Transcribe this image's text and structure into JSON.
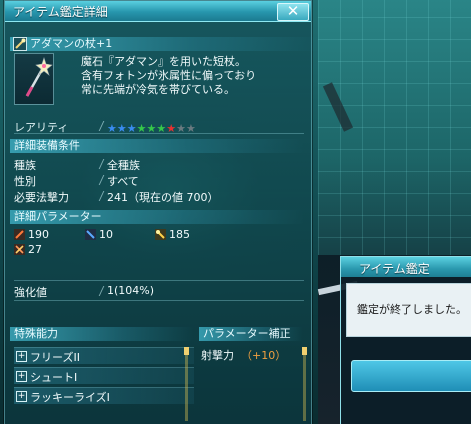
{
  "window": {
    "title": "アイテム鑑定詳細",
    "close_label": "✕"
  },
  "item": {
    "name": "アダマンの杖+1",
    "description_lines": [
      "魔石『アダマン』を用いた短杖。",
      "含有フォトンが氷属性に偏っており",
      "常に先端が冷気を帯びている。"
    ],
    "rarity_label": "レアリティ",
    "rarity_stars": [
      {
        "glyph": "★",
        "color": "#3a8cf0"
      },
      {
        "glyph": "★",
        "color": "#3a8cf0"
      },
      {
        "glyph": "★",
        "color": "#3a8cf0"
      },
      {
        "glyph": "★",
        "color": "#35c84a"
      },
      {
        "glyph": "★",
        "color": "#35c84a"
      },
      {
        "glyph": "★",
        "color": "#35c84a"
      },
      {
        "glyph": "★",
        "color": "#e83030"
      },
      {
        "glyph": "★",
        "color": "#6a7a80"
      },
      {
        "glyph": "★",
        "color": "#6a7a80"
      }
    ]
  },
  "equip_conditions": {
    "header": "詳細装備条件",
    "rows": [
      {
        "label": "種族",
        "value": "全種族"
      },
      {
        "label": "性別",
        "value": "すべて"
      },
      {
        "label": "必要法撃力",
        "value": "241（現在の値 700）"
      }
    ]
  },
  "parameters": {
    "header": "詳細パラメーター",
    "stats": [
      {
        "icon": "sword-icon",
        "value": "190"
      },
      {
        "icon": "gun-icon",
        "value": "10"
      },
      {
        "icon": "wand-icon",
        "value": "185"
      },
      {
        "icon": "crossed-icon",
        "value": "27"
      }
    ]
  },
  "enhance": {
    "label": "強化値",
    "value": "1(104%)"
  },
  "special_abilities": {
    "header": "特殊能力",
    "items": [
      "フリーズII",
      "シュートI",
      "ラッキーライズI"
    ]
  },
  "param_bonus": {
    "header": "パラメーター補正",
    "rows": [
      {
        "label": "射撃力",
        "value": "（+10）"
      }
    ]
  },
  "dialog": {
    "title": "アイテム鑑定",
    "message": "鑑定が終了しました。"
  },
  "colors": {
    "accent": "#3aa9be",
    "bonus_value": "#f0a040"
  }
}
